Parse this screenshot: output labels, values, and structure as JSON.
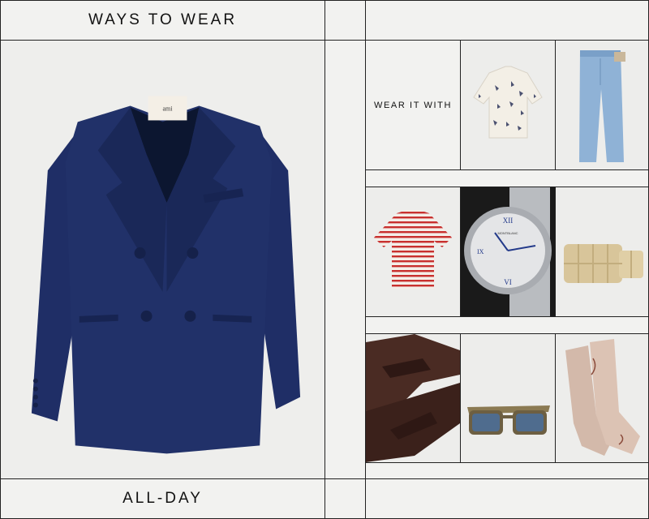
{
  "header": {
    "title": "WAYS TO WEAR"
  },
  "footer": {
    "title": "ALL-DAY"
  },
  "side_panel": {
    "label": "WEAR IT WITH"
  },
  "hero": {
    "product": "navy double-breasted blazer",
    "brand_label": "ami"
  },
  "grid_items": [
    {
      "name": "printed shirt"
    },
    {
      "name": "light wash jeans"
    },
    {
      "name": "striped t-shirt"
    },
    {
      "name": "watch",
      "brand": "MONTBLANC"
    },
    {
      "name": "woven leather bag"
    },
    {
      "name": "brown penny loafers"
    },
    {
      "name": "tinted sunglasses"
    },
    {
      "name": "beige socks"
    }
  ],
  "colors": {
    "navy": "#1e2d63",
    "border": "#222222",
    "background": "#f2f2f0"
  }
}
